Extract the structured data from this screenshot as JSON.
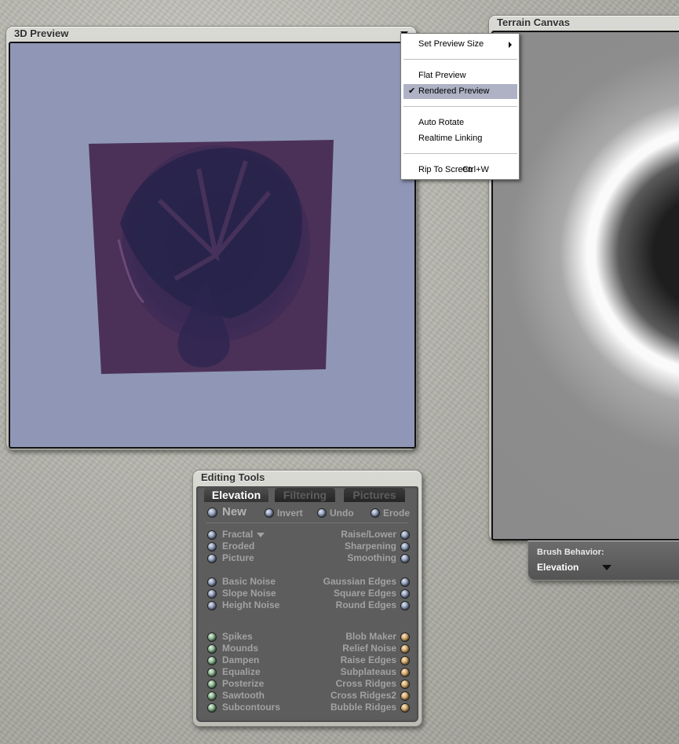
{
  "preview": {
    "title": "3D Preview"
  },
  "canvas": {
    "title": "Terrain Canvas"
  },
  "brush": {
    "label": "Brush Behavior:",
    "value": "Elevation"
  },
  "context_menu": {
    "items": [
      {
        "label": "Set Preview Size",
        "submenu": true
      },
      {
        "label": "Flat Preview"
      },
      {
        "label": "Rendered Preview",
        "checked": true,
        "check_glyph": "✔"
      },
      {
        "label": "Auto Rotate"
      },
      {
        "label": "Realtime Linking"
      },
      {
        "label": "Rip To Screen",
        "shortcut": "Ctrl+W"
      }
    ]
  },
  "tools": {
    "title": "Editing Tools",
    "tabs": [
      "Elevation",
      "Filtering",
      "Pictures"
    ],
    "top": {
      "new": "New",
      "invert": "Invert",
      "undo": "Undo",
      "erode": "Erode"
    },
    "group1_left": [
      "Fractal",
      "Eroded",
      "Picture"
    ],
    "group1_right": [
      "Raise/Lower",
      "Sharpening",
      "Smoothing"
    ],
    "group2_left": [
      "Basic Noise",
      "Slope Noise",
      "Height Noise"
    ],
    "group2_right": [
      "Gaussian Edges",
      "Square Edges",
      "Round Edges"
    ],
    "group3_left": [
      "Spikes",
      "Mounds",
      "Dampen",
      "Equalize",
      "Posterize",
      "Sawtooth",
      "Subcontours"
    ],
    "group3_right": [
      "Blob Maker",
      "Relief Noise",
      "Raise Edges",
      "Subplateaus",
      "Cross Ridges",
      "Cross Ridges2",
      "Bubble Ridges"
    ]
  },
  "colors": {
    "preview_bg": "#9097b6",
    "terrain": "#3f2c52",
    "menu_highlight": "#aeb2c4"
  }
}
